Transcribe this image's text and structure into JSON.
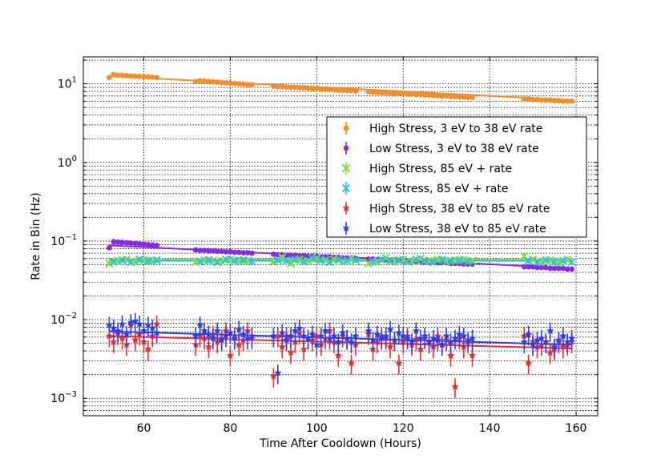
{
  "chart_data": {
    "type": "scatter",
    "title": "",
    "xlabel": "Time After Cooldown (Hours)",
    "ylabel": "Rate in Bin (Hz)",
    "xlim": [
      46,
      165
    ],
    "ylim": [
      0.0006,
      22
    ],
    "yscale": "log",
    "grid": true,
    "legend_position": "right",
    "xticks": [
      {
        "value": 60,
        "label": "60"
      },
      {
        "value": 80,
        "label": "80"
      },
      {
        "value": 100,
        "label": "100"
      },
      {
        "value": 120,
        "label": "120"
      },
      {
        "value": 140,
        "label": "140"
      },
      {
        "value": 160,
        "label": "160"
      }
    ],
    "yticks": [
      {
        "value": 0.001,
        "base": "10",
        "exp": "−3"
      },
      {
        "value": 0.01,
        "base": "10",
        "exp": "−2"
      },
      {
        "value": 0.1,
        "base": "10",
        "exp": "−1"
      },
      {
        "value": 1,
        "base": "10",
        "exp": "0"
      },
      {
        "value": 10,
        "base": "10",
        "exp": "1"
      }
    ],
    "series": [
      {
        "name": "High Stress, 3 eV to 38 eV rate",
        "color": "#f28e2b",
        "marker": "circle",
        "x": [
          52,
          53,
          54,
          55,
          56,
          57,
          58,
          59,
          60,
          61,
          62,
          63,
          72,
          73,
          74,
          75,
          76,
          77,
          78,
          79,
          80,
          81,
          82,
          83,
          84,
          85,
          90,
          91,
          92,
          93,
          94,
          95,
          96,
          97,
          98,
          99,
          100,
          101,
          102,
          103,
          104,
          105,
          106,
          107,
          108,
          109,
          112,
          113,
          114,
          115,
          116,
          117,
          118,
          119,
          120,
          121,
          122,
          123,
          124,
          125,
          126,
          127,
          128,
          129,
          130,
          131,
          132,
          133,
          134,
          135,
          136,
          148,
          149,
          150,
          151,
          152,
          153,
          154,
          155,
          156,
          157,
          158,
          159
        ],
        "y": [
          12.0,
          13.1,
          12.9,
          12.8,
          12.7,
          12.6,
          12.5,
          12.4,
          12.3,
          12.2,
          12.1,
          12.0,
          10.7,
          10.9,
          10.8,
          10.7,
          10.6,
          10.5,
          10.4,
          10.3,
          10.2,
          10.1,
          10.0,
          9.9,
          9.8,
          9.7,
          9.3,
          9.2,
          9.2,
          9.1,
          9.0,
          9.0,
          8.9,
          8.9,
          8.8,
          8.7,
          8.7,
          8.6,
          8.5,
          8.5,
          8.4,
          8.3,
          8.3,
          8.2,
          8.2,
          8.1,
          7.9,
          7.8,
          7.8,
          7.7,
          7.7,
          7.6,
          7.6,
          7.5,
          7.5,
          7.4,
          7.4,
          7.3,
          7.3,
          7.2,
          7.2,
          7.1,
          7.1,
          7.0,
          7.0,
          6.9,
          6.9,
          6.8,
          6.8,
          6.7,
          6.7,
          6.4,
          6.4,
          6.3,
          6.3,
          6.2,
          6.2,
          6.2,
          6.1,
          6.1,
          6.0,
          6.0,
          6.0
        ],
        "fit": [
          [
            52,
            12.5
          ],
          [
            159,
            6.2
          ]
        ]
      },
      {
        "name": "Low Stress, 3 eV to 38 eV rate",
        "color": "#8a2be2",
        "marker": "circle",
        "x": [
          52,
          53,
          54,
          55,
          56,
          57,
          58,
          59,
          60,
          61,
          62,
          63,
          72,
          73,
          74,
          75,
          76,
          77,
          78,
          79,
          80,
          81,
          82,
          83,
          84,
          85,
          90,
          91,
          92,
          93,
          94,
          95,
          96,
          97,
          98,
          99,
          100,
          101,
          102,
          103,
          104,
          105,
          106,
          107,
          108,
          109,
          112,
          113,
          114,
          115,
          116,
          117,
          118,
          119,
          120,
          121,
          122,
          123,
          124,
          125,
          126,
          127,
          128,
          129,
          130,
          131,
          132,
          133,
          134,
          135,
          136,
          148,
          149,
          150,
          151,
          152,
          153,
          154,
          155,
          156,
          157,
          158,
          159
        ],
        "y": [
          0.082,
          0.098,
          0.097,
          0.096,
          0.095,
          0.094,
          0.093,
          0.092,
          0.091,
          0.09,
          0.089,
          0.088,
          0.077,
          0.076,
          0.076,
          0.075,
          0.075,
          0.074,
          0.074,
          0.073,
          0.073,
          0.072,
          0.072,
          0.071,
          0.071,
          0.07,
          0.068,
          0.067,
          0.067,
          0.066,
          0.066,
          0.066,
          0.065,
          0.065,
          0.064,
          0.064,
          0.064,
          0.063,
          0.063,
          0.063,
          0.062,
          0.062,
          0.061,
          0.061,
          0.061,
          0.06,
          0.059,
          0.059,
          0.058,
          0.058,
          0.058,
          0.057,
          0.057,
          0.057,
          0.056,
          0.056,
          0.055,
          0.055,
          0.055,
          0.054,
          0.054,
          0.054,
          0.053,
          0.053,
          0.053,
          0.052,
          0.052,
          0.052,
          0.051,
          0.051,
          0.051,
          0.047,
          0.047,
          0.047,
          0.046,
          0.046,
          0.046,
          0.045,
          0.045,
          0.045,
          0.045,
          0.044,
          0.044
        ],
        "fit": [
          [
            52,
            0.088
          ],
          [
            159,
            0.045
          ]
        ]
      },
      {
        "name": "High Stress, 85 eV + rate",
        "color": "#7fe030",
        "marker": "x",
        "x": [
          52,
          54,
          56,
          58,
          60,
          62,
          72,
          74,
          76,
          78,
          80,
          82,
          84,
          90,
          92,
          94,
          96,
          98,
          100,
          102,
          104,
          106,
          108,
          112,
          114,
          116,
          118,
          120,
          122,
          124,
          126,
          128,
          130,
          132,
          134,
          136,
          148,
          150,
          152,
          154,
          156,
          158
        ],
        "y": [
          0.052,
          0.056,
          0.058,
          0.055,
          0.057,
          0.056,
          0.054,
          0.057,
          0.056,
          0.055,
          0.058,
          0.057,
          0.056,
          0.055,
          0.062,
          0.052,
          0.058,
          0.056,
          0.06,
          0.057,
          0.058,
          0.055,
          0.06,
          0.052,
          0.055,
          0.061,
          0.056,
          0.058,
          0.055,
          0.06,
          0.056,
          0.058,
          0.055,
          0.057,
          0.058,
          0.056,
          0.064,
          0.058,
          0.055,
          0.057,
          0.053,
          0.058
        ],
        "fit": [
          [
            52,
            0.058
          ],
          [
            159,
            0.058
          ]
        ]
      },
      {
        "name": "Low Stress, 85 eV + rate",
        "color": "#29c4e6",
        "marker": "x",
        "x": [
          53,
          55,
          57,
          59,
          61,
          63,
          73,
          75,
          77,
          79,
          81,
          83,
          85,
          91,
          93,
          95,
          97,
          99,
          101,
          103,
          105,
          107,
          109,
          113,
          115,
          117,
          119,
          121,
          123,
          125,
          127,
          129,
          131,
          133,
          135,
          149,
          151,
          153,
          155,
          157,
          159
        ],
        "y": [
          0.055,
          0.057,
          0.054,
          0.058,
          0.056,
          0.057,
          0.055,
          0.057,
          0.054,
          0.058,
          0.056,
          0.057,
          0.055,
          0.057,
          0.056,
          0.058,
          0.055,
          0.06,
          0.057,
          0.054,
          0.058,
          0.056,
          0.057,
          0.055,
          0.058,
          0.056,
          0.057,
          0.055,
          0.058,
          0.056,
          0.054,
          0.058,
          0.056,
          0.057,
          0.055,
          0.056,
          0.054,
          0.057,
          0.055,
          0.056,
          0.054
        ],
        "fit": [
          [
            52,
            0.056
          ],
          [
            159,
            0.056
          ]
        ]
      },
      {
        "name": "High Stress, 38 eV to 85 eV rate",
        "color": "#ee2b2b",
        "marker": "star",
        "x": [
          52,
          53,
          54,
          55,
          56,
          57,
          58,
          59,
          60,
          61,
          62,
          63,
          72,
          73,
          74,
          75,
          76,
          77,
          78,
          79,
          80,
          81,
          82,
          83,
          84,
          85,
          90,
          91,
          92,
          93,
          94,
          95,
          96,
          97,
          98,
          99,
          100,
          101,
          102,
          103,
          104,
          105,
          106,
          107,
          108,
          109,
          112,
          113,
          114,
          115,
          116,
          117,
          118,
          119,
          120,
          121,
          122,
          123,
          124,
          125,
          126,
          127,
          128,
          129,
          130,
          131,
          132,
          133,
          134,
          135,
          136,
          148,
          149,
          150,
          151,
          152,
          153,
          154,
          155,
          156,
          157,
          158,
          159
        ],
        "y": [
          0.0062,
          0.0052,
          0.0066,
          0.0058,
          0.0048,
          0.0085,
          0.0055,
          0.0065,
          0.0052,
          0.0042,
          0.0062,
          0.0088,
          0.0048,
          0.0062,
          0.0058,
          0.0045,
          0.0065,
          0.0052,
          0.0058,
          0.0072,
          0.0035,
          0.0062,
          0.0048,
          0.0055,
          0.0072,
          0.0058,
          0.0019,
          0.0062,
          0.0045,
          0.0062,
          0.0038,
          0.0052,
          0.0068,
          0.0042,
          0.0058,
          0.0055,
          0.0062,
          0.0048,
          0.0058,
          0.0072,
          0.0052,
          0.0035,
          0.0062,
          0.0058,
          0.0028,
          0.0048,
          0.0066,
          0.0042,
          0.0052,
          0.0062,
          0.0058,
          0.0045,
          0.0055,
          0.0028,
          0.0052,
          0.0062,
          0.0048,
          0.0056,
          0.0042,
          0.0058,
          0.0052,
          0.0045,
          0.0062,
          0.0048,
          0.0055,
          0.0035,
          0.0014,
          0.0058,
          0.0045,
          0.0052,
          0.0035,
          0.0062,
          0.0028,
          0.0052,
          0.0045,
          0.0048,
          0.0052,
          0.0038,
          0.0042,
          0.0052,
          0.0045,
          0.0048,
          0.0052
        ],
        "fit": [
          [
            52,
            0.0062
          ],
          [
            159,
            0.0043
          ]
        ]
      },
      {
        "name": "Low Stress, 38 eV to 85 eV rate",
        "color": "#2b3df0",
        "marker": "star",
        "x": [
          52,
          53,
          54,
          55,
          56,
          57,
          58,
          59,
          60,
          61,
          62,
          63,
          72,
          73,
          74,
          75,
          76,
          77,
          78,
          79,
          80,
          81,
          82,
          83,
          84,
          85,
          90,
          91,
          92,
          93,
          94,
          95,
          96,
          97,
          98,
          99,
          100,
          101,
          102,
          103,
          104,
          105,
          106,
          107,
          108,
          109,
          112,
          113,
          114,
          115,
          116,
          117,
          118,
          119,
          120,
          121,
          122,
          123,
          124,
          125,
          126,
          127,
          128,
          129,
          130,
          131,
          132,
          133,
          134,
          135,
          136,
          148,
          149,
          150,
          151,
          152,
          153,
          154,
          155,
          156,
          157,
          158,
          159
        ],
        "y": [
          0.0085,
          0.0078,
          0.0072,
          0.0088,
          0.0065,
          0.0092,
          0.0095,
          0.0088,
          0.0072,
          0.0085,
          0.0078,
          0.0068,
          0.0062,
          0.0085,
          0.0072,
          0.0065,
          0.0058,
          0.0072,
          0.0055,
          0.0062,
          0.0068,
          0.0058,
          0.0075,
          0.0065,
          0.0058,
          0.0062,
          0.0062,
          0.0021,
          0.0068,
          0.0055,
          0.0062,
          0.0072,
          0.0078,
          0.0062,
          0.0058,
          0.0065,
          0.0048,
          0.0062,
          0.0072,
          0.0058,
          0.0062,
          0.0052,
          0.0068,
          0.0058,
          0.0052,
          0.0062,
          0.0072,
          0.0055,
          0.0065,
          0.0058,
          0.0062,
          0.0075,
          0.0055,
          0.0068,
          0.0062,
          0.0058,
          0.0052,
          0.0072,
          0.0058,
          0.0062,
          0.0052,
          0.0058,
          0.0055,
          0.0048,
          0.0062,
          0.0052,
          0.0058,
          0.0065,
          0.0062,
          0.0055,
          0.0058,
          0.0052,
          0.0065,
          0.0048,
          0.0055,
          0.0058,
          0.0052,
          0.0072,
          0.0045,
          0.0055,
          0.0062,
          0.0052,
          0.0058
        ],
        "fit": [
          [
            52,
            0.0071
          ],
          [
            159,
            0.0048
          ]
        ]
      }
    ]
  }
}
